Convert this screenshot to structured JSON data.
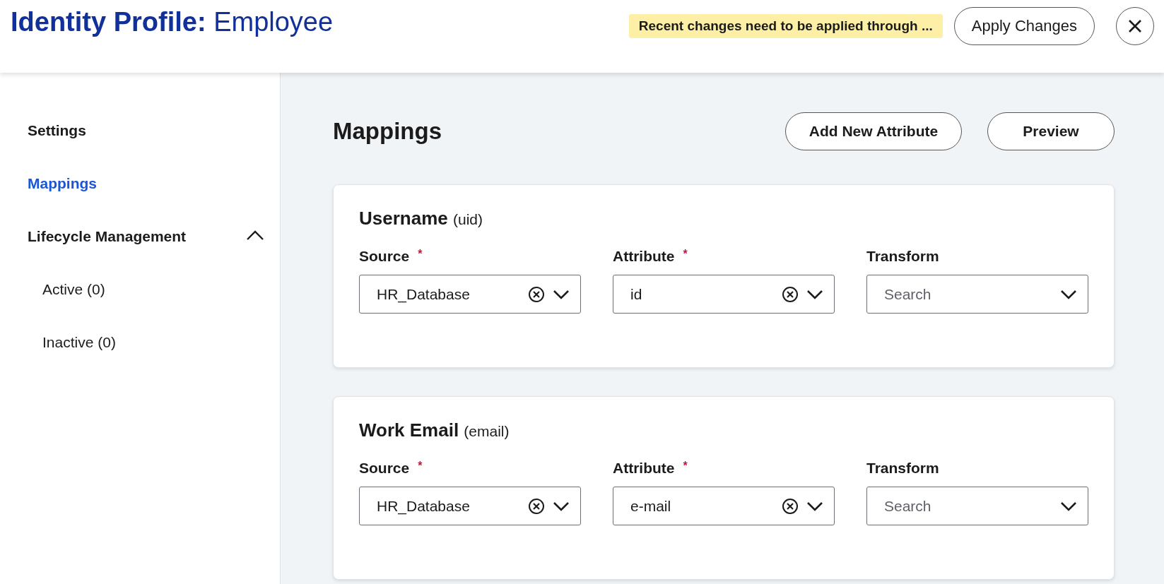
{
  "header": {
    "title_bold": "Identity Profile:",
    "title_rest": "Employee",
    "notice": "Recent changes need to be applied through ...",
    "apply_button": "Apply Changes"
  },
  "sidebar": {
    "items": [
      {
        "label": "Settings",
        "selected": false
      },
      {
        "label": "Mappings",
        "selected": true
      },
      {
        "label": "Lifecycle Management",
        "selected": false,
        "expanded": true,
        "children": [
          {
            "label": "Active (0)",
            "selected": false
          },
          {
            "label": "Inactive (0)",
            "selected": false
          }
        ]
      }
    ]
  },
  "main": {
    "heading": "Mappings",
    "buttons": [
      "Add New Attribute",
      "Preview"
    ],
    "cards": [
      {
        "title": "Username",
        "key": "(uid)",
        "fields": [
          {
            "label": "Source",
            "required_mark": "*",
            "value": "HR_Database"
          },
          {
            "label": "Attribute",
            "required_mark": "*",
            "value": "id"
          },
          {
            "label": "Transform",
            "placeholder": "Search"
          }
        ]
      },
      {
        "title": "Work Email",
        "key": "(email)",
        "fields": [
          {
            "label": "Source",
            "required_mark": "*",
            "value": "HR_Database"
          },
          {
            "label": "Attribute",
            "required_mark": "*",
            "value": "e-mail"
          },
          {
            "label": "Transform",
            "placeholder": "Search"
          }
        ]
      }
    ]
  }
}
